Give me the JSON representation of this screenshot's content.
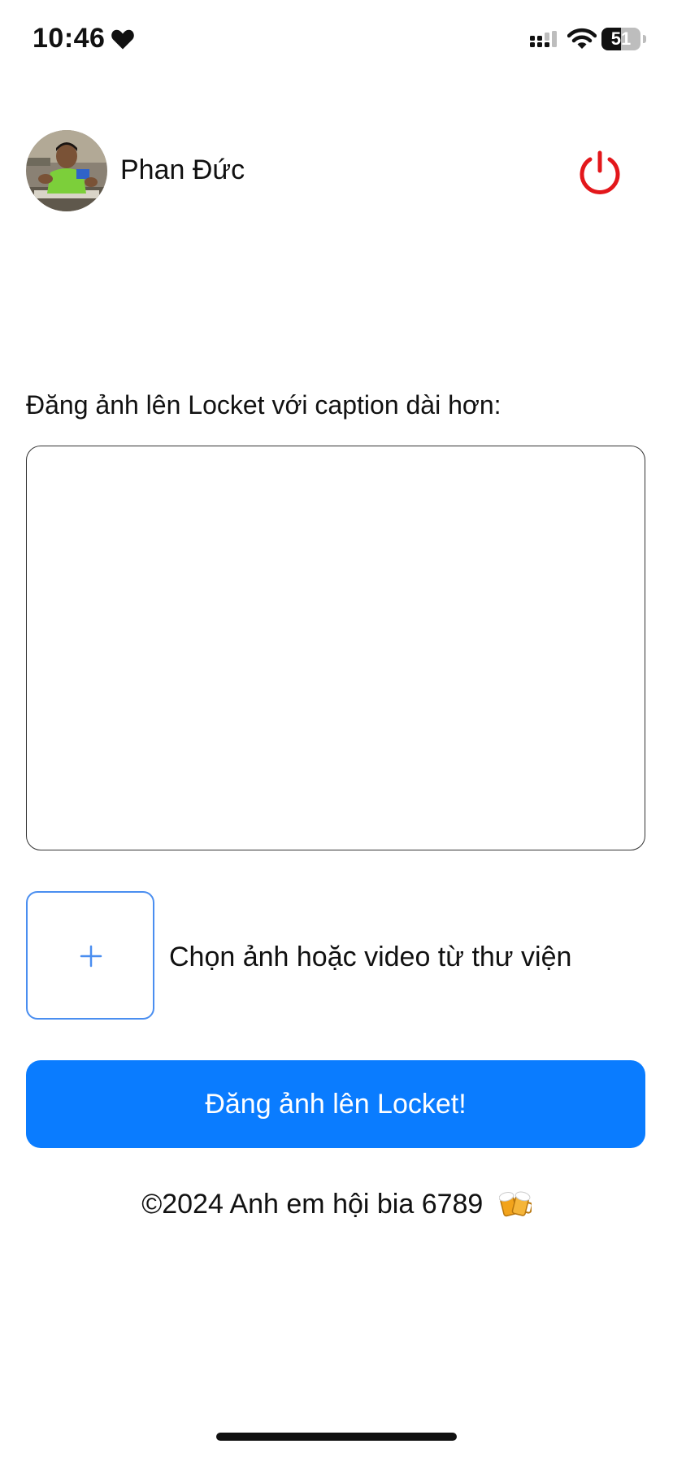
{
  "status_bar": {
    "time": "10:46",
    "battery_level": "51",
    "battery_fraction": 0.51,
    "icons": [
      "heart-icon",
      "signal-icon",
      "wifi-icon",
      "battery-icon"
    ]
  },
  "profile": {
    "name": "Phan Đức",
    "avatar_icon": "avatar-photo",
    "logout_icon": "power-icon",
    "logout_color": "#e3171b"
  },
  "caption": {
    "label": "Đăng ảnh lên Locket với caption dài hơn:",
    "value": "",
    "placeholder": ""
  },
  "media": {
    "picker_icon": "plus-icon",
    "label": "Chọn ảnh hoặc video từ thư viện",
    "accent_color": "#4a8ef0"
  },
  "post_button": {
    "label": "Đăng ảnh lên Locket!",
    "color": "#0a7cff"
  },
  "footer": {
    "text": "©2024 Anh em hội bia 6789",
    "icon": "beer-mugs-icon"
  }
}
